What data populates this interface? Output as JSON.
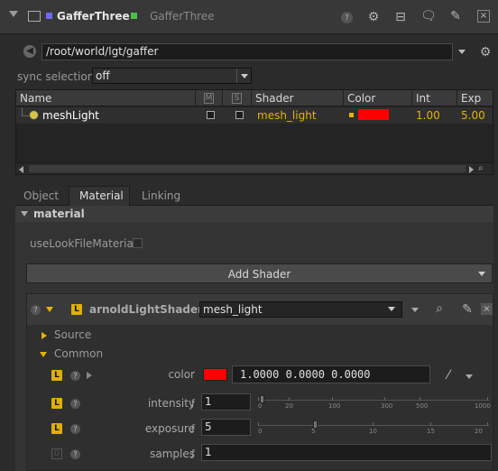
{
  "titlebar": {
    "node_name": "GafferThree",
    "node_type": "GafferThree"
  },
  "path": {
    "value": "/root/world/lgt/gaffer"
  },
  "sync": {
    "label": "sync selection",
    "value": "off"
  },
  "table": {
    "headers": {
      "name": "Name",
      "m": "M",
      "s": "S",
      "shader": "Shader",
      "color": "Color",
      "int": "Int",
      "exp": "Exp"
    },
    "row": {
      "name": "meshLight",
      "shader": "mesh_light",
      "color_hex": "#ff0000",
      "int": "1.00",
      "exp": "5.00"
    }
  },
  "tabs": [
    {
      "label": "Object"
    },
    {
      "label": "Material"
    },
    {
      "label": "Linking"
    }
  ],
  "active_tab": "Material",
  "material": {
    "section_label": "material",
    "use_look_file": "useLookFileMaterial",
    "add_shader": "Add Shader",
    "shader_type": "arnoldLightShader",
    "shader_name": "mesh_light",
    "source_label": "Source",
    "common_label": "Common",
    "params": {
      "color": {
        "label": "color",
        "swatch": "#ff0000",
        "value": "1.0000  0.0000  0.0000"
      },
      "intensity": {
        "label": "intensity",
        "value": "1",
        "ticks": [
          "0",
          "20",
          "100",
          "300",
          "500",
          "1000"
        ],
        "slider_value": 1
      },
      "exposure": {
        "label": "exposure",
        "value": "5",
        "ticks": [
          "0",
          "5",
          "10",
          "15",
          "20"
        ],
        "slider_value": 5
      },
      "samples": {
        "label": "samples",
        "value": "1"
      }
    }
  },
  "colors": {
    "accent_yellow": "#e0b000",
    "shader_text": "#e6b400",
    "value_text": "#e6b400"
  }
}
